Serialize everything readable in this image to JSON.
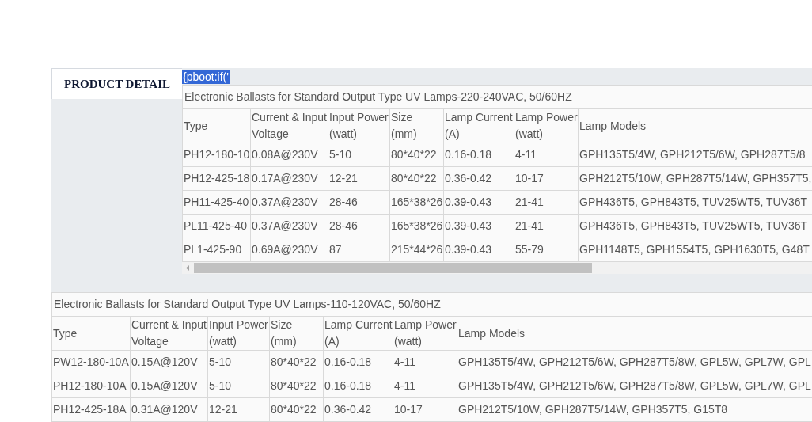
{
  "panel": {
    "tabs": [
      {
        "label": "PRODUCT DETAIL",
        "selected": true
      }
    ],
    "template_text": {
      "text": "{pboot:if('",
      "selected": true
    },
    "table": {
      "caption": "Electronic Ballasts for Standard Output Type UV Lamps-220-240VAC, 50/60HZ",
      "scrollbar": true,
      "columns": [
        "Type",
        "Current & Input\nVoltage",
        "Input Power\n(watt)",
        "Size\n(mm)",
        "Lamp Current\n(A)",
        "Lamp Power\n(watt)",
        "Lamp Models"
      ],
      "rows": [
        [
          "PH12-180-10",
          "0.08A@230V",
          "5-10",
          "80*40*22",
          "0.16-0.18",
          "4-11",
          "GPH135T5/4W, GPH212T5/6W, GPH287T5/8"
        ],
        [
          "PH12-425-18",
          "0.17A@230V",
          "12-21",
          "80*40*22",
          "0.36-0.42",
          "10-17",
          "GPH212T5/10W, GPH287T5/14W, GPH357T5,"
        ],
        [
          "PH11-425-40",
          "0.37A@230V",
          "28-46",
          "165*38*26",
          "0.39-0.43",
          "21-41",
          "GPH436T5, GPH843T5, TUV25WT5, TUV36T"
        ],
        [
          "PL11-425-40",
          "0.37A@230V",
          "28-46",
          "165*38*26",
          "0.39-0.43",
          "21-41",
          "GPH436T5, GPH843T5, TUV25WT5, TUV36T"
        ],
        [
          "PL1-425-90",
          "0.69A@230V",
          "87",
          "215*44*26",
          "0.39-0.43",
          "55-79",
          "GPH1148T5, GPH1554T5, GPH1630T5, G48T"
        ]
      ]
    }
  },
  "tables": [
    {
      "caption": "Electronic Ballasts for Standard Output Type UV Lamps-110-120VAC, 50/60HZ",
      "columns": [
        "Type",
        "Current & Input\nVoltage",
        "Input Power\n(watt)",
        "Size\n(mm)",
        "Lamp Current\n(A)",
        "Lamp Power\n(watt)",
        "Lamp Models"
      ],
      "rows": [
        [
          "PW12-180-10A",
          "0.15A@120V",
          "5-10",
          "80*40*22",
          "0.16-0.18",
          "4-11",
          "GPH135T5/4W, GPH212T5/6W, GPH287T5/8W, GPL5W, GPL7W, GPL"
        ],
        [
          "PH12-180-10A",
          "0.15A@120V",
          "5-10",
          "80*40*22",
          "0.16-0.18",
          "4-11",
          "GPH135T5/4W, GPH212T5/6W, GPH287T5/8W, GPL5W, GPL7W, GPL"
        ],
        [
          "PH12-425-18A",
          "0.31A@120V",
          "12-21",
          "80*40*22",
          "0.36-0.42",
          "10-17",
          "GPH212T5/10W, GPH287T5/14W, GPH357T5, G15T8"
        ]
      ]
    }
  ]
}
